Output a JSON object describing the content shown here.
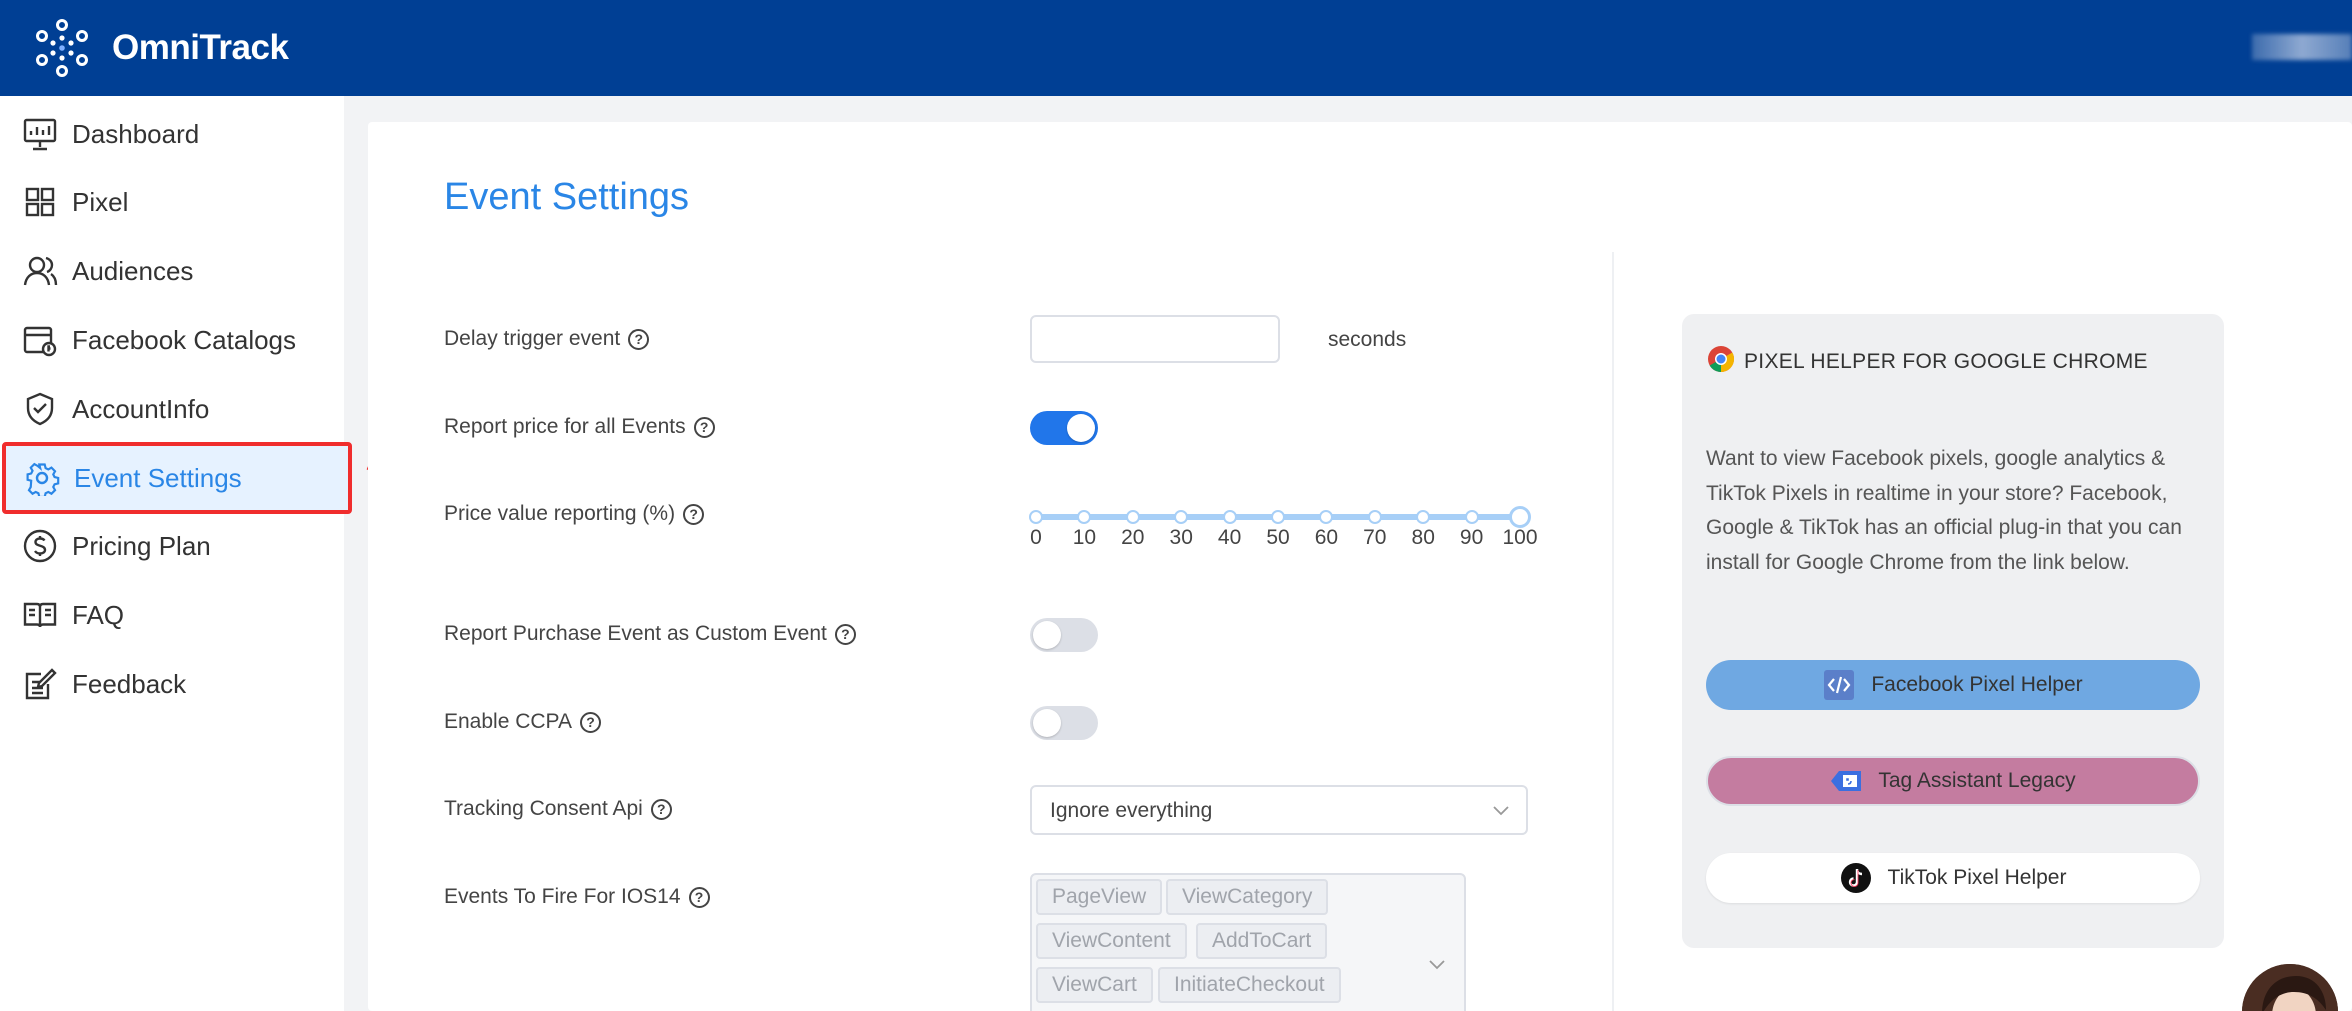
{
  "app": {
    "name": "OmniTrack"
  },
  "colors": {
    "header": "#003f94",
    "accent": "#2a86e6",
    "highlight": "#f02d2d",
    "toggle_on": "#2176ea",
    "slider": "#a7cff7"
  },
  "sidebar": {
    "items": [
      {
        "label": "Dashboard",
        "icon": "dashboard-icon"
      },
      {
        "label": "Pixel",
        "icon": "grid-icon"
      },
      {
        "label": "Audiences",
        "icon": "users-icon"
      },
      {
        "label": "Facebook Catalogs",
        "icon": "catalog-icon"
      },
      {
        "label": "AccountInfo",
        "icon": "shield-icon"
      },
      {
        "label": "Event Settings",
        "icon": "gear-icon",
        "active": true
      },
      {
        "label": "Pricing Plan",
        "icon": "dollar-icon"
      },
      {
        "label": "FAQ",
        "icon": "book-icon"
      },
      {
        "label": "Feedback",
        "icon": "edit-icon"
      }
    ]
  },
  "main": {
    "title": "Event Settings",
    "delay_trigger": {
      "label": "Delay trigger event",
      "value": "",
      "unit": "seconds"
    },
    "report_price": {
      "label": "Report price for all Events",
      "enabled": true
    },
    "price_value": {
      "label": "Price value reporting (%)",
      "ticks": [
        "0",
        "10",
        "20",
        "30",
        "40",
        "50",
        "60",
        "70",
        "80",
        "90",
        "100"
      ],
      "value": 100
    },
    "report_purchase_custom": {
      "label": "Report Purchase Event as Custom Event",
      "enabled": false
    },
    "enable_ccpa": {
      "label": "Enable CCPA",
      "enabled": false
    },
    "tracking_consent": {
      "label": "Tracking Consent Api",
      "selected": "Ignore everything"
    },
    "ios14_events": {
      "label": "Events To Fire For IOS14",
      "tags": [
        "PageView",
        "ViewCategory",
        "ViewContent",
        "AddToCart",
        "ViewCart",
        "InitiateCheckout"
      ]
    }
  },
  "helper_panel": {
    "title": "PIXEL HELPER FOR GOOGLE CHROME",
    "description": "Want to view Facebook pixels, google analytics & TikTok Pixels in realtime in your store? Facebook, Google & TikTok has an official plug-in that you can install for Google Chrome from the link below.",
    "buttons": {
      "facebook": "Facebook Pixel Helper",
      "tag_assistant": "Tag Assistant Legacy",
      "tiktok": "TikTok Pixel Helper"
    }
  }
}
